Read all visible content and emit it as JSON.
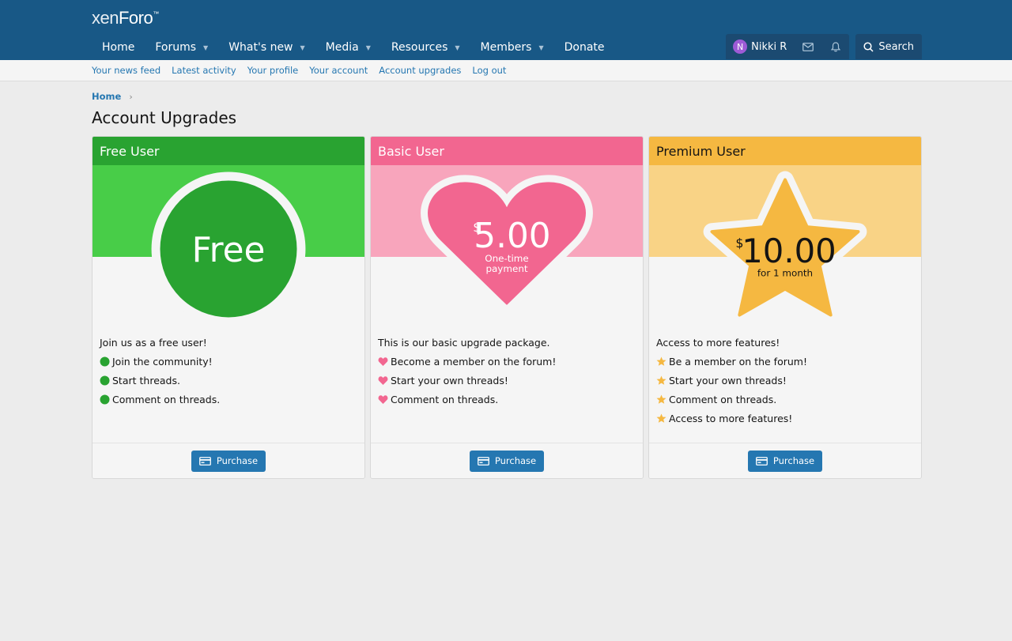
{
  "logo": {
    "text_a": "xen",
    "text_b": "Foro",
    "tm": "™"
  },
  "nav": {
    "items": [
      {
        "label": "Home",
        "has_caret": false
      },
      {
        "label": "Forums",
        "has_caret": true
      },
      {
        "label": "What's new",
        "has_caret": true
      },
      {
        "label": "Media",
        "has_caret": true
      },
      {
        "label": "Resources",
        "has_caret": true
      },
      {
        "label": "Members",
        "has_caret": true
      },
      {
        "label": "Donate",
        "has_caret": false
      }
    ],
    "user": {
      "initial": "N",
      "name": "Nikki R",
      "avatar_color": "#9e5bd6"
    },
    "search_label": "Search"
  },
  "subnav": {
    "links": [
      "Your news feed",
      "Latest activity",
      "Your profile",
      "Your account",
      "Account upgrades",
      "Log out"
    ]
  },
  "breadcrumb": {
    "home": "Home"
  },
  "page_title": "Account Upgrades",
  "cards": [
    {
      "title": "Free User",
      "header_color": "#29a331",
      "banner_color": "#48cd48",
      "shape": "circle",
      "shape_color": "#29a331",
      "price_big": "Free",
      "intro": "Join us as a free user!",
      "feature_icon": "circle-icon",
      "features": [
        "Join the community!",
        "Start threads.",
        "Comment on threads."
      ],
      "button": "Purchase"
    },
    {
      "title": "Basic User",
      "header_color": "#f26690",
      "banner_color": "#f8a5bc",
      "shape": "heart",
      "shape_color": "#f26690",
      "currency": "$",
      "price": "5.00",
      "price_note_1": "One-time",
      "price_note_2": "payment",
      "intro": "This is our basic upgrade package.",
      "feature_icon": "heart-icon",
      "features": [
        "Become a member on the forum!",
        "Start your own threads!",
        "Comment on threads."
      ],
      "button": "Purchase"
    },
    {
      "title": "Premium User",
      "header_color": "#f5b841",
      "banner_color": "#f9d386",
      "shape": "star",
      "shape_color": "#f5b841",
      "currency": "$",
      "price": "10.00",
      "price_note_1": "for 1 month",
      "intro": "Access to more features!",
      "feature_icon": "star-icon",
      "features": [
        "Be a member on the forum!",
        "Start your own threads!",
        "Comment on threads.",
        "Access to more features!"
      ],
      "button": "Purchase"
    }
  ]
}
